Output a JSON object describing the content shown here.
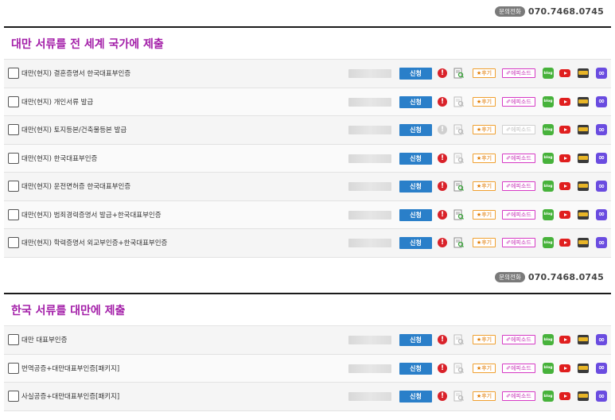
{
  "contact": {
    "badge": "문의전화",
    "phone": "070.7468.0745"
  },
  "buttons": {
    "apply": "신청",
    "review": "★후기",
    "episode": "✐에피소드",
    "blog": "blog",
    "link": "∞"
  },
  "sections": [
    {
      "title": "대만 서류를 전 세계 국가에 제출",
      "rows": [
        {
          "label": "대만(현지) 결혼증명서 한국대표부인증"
        },
        {
          "label": "대만(현지) 개인서류 발급"
        },
        {
          "label": "대만(현지) 토지등본/건축물등본 발급"
        },
        {
          "label": "대만(현지) 한국대표부인증"
        },
        {
          "label": "대만(현지) 운전면허증 한국대표부인증"
        },
        {
          "label": "대만(현지) 범죄경력증명서 발급+한국대표부인증"
        },
        {
          "label": "대만(현지) 학력증명서 외교부인증+한국대표부인증"
        }
      ]
    },
    {
      "title": "한국 서류를 대만에 제출",
      "rows": [
        {
          "label": "대만 대표부인증"
        },
        {
          "label": "번역공증+대만대표부인증[패키지]"
        },
        {
          "label": "사실공증+대만대표부인증[패키지]"
        }
      ]
    }
  ],
  "colors": {
    "accent": "#a31ea8",
    "apply": "#2a7fc9",
    "warn": "#d9222a",
    "review": "#f0a030",
    "episode": "#d63ac5",
    "blog": "#47b23b",
    "youtube": "#e01f1f",
    "link": "#6a4ce0"
  }
}
